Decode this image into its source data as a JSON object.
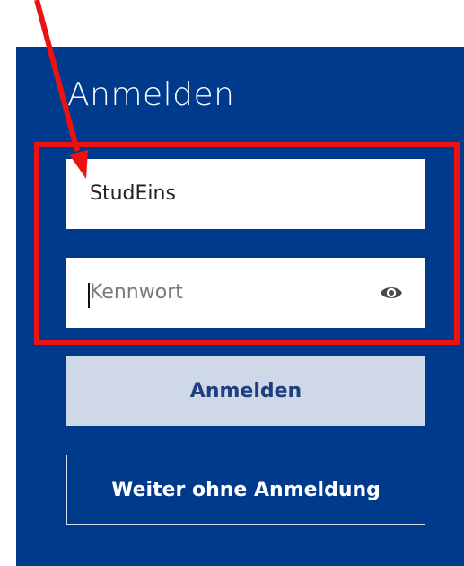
{
  "login": {
    "title": "Anmelden",
    "username_value": "StudEins",
    "password_placeholder": "Kennwort",
    "login_button_label": "Anmelden",
    "guest_button_label": "Weiter ohne Anmeldung"
  },
  "icons": {
    "password_visibility": "eye-icon"
  },
  "annotations": {
    "highlight_color": "#ee1111",
    "arrow_color": "#ee1111"
  },
  "colors": {
    "panel_background": "#003a8c",
    "login_button_background": "#cfd8e6",
    "login_button_text": "#1f3f82"
  }
}
